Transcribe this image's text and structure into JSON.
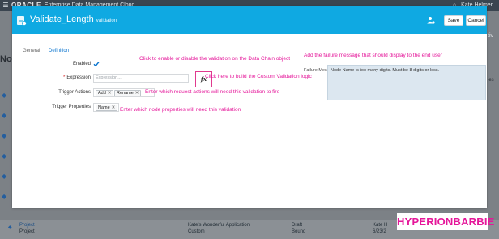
{
  "topbar": {
    "brand": "ORACLE",
    "product": "Enterprise Data Management Cloud",
    "user": "Kate Helmer",
    "home_glyph": "⌂"
  },
  "background": {
    "left_letters": "No",
    "right_text": "tiv",
    "right_text2": "ies",
    "row": {
      "name": "Project",
      "sub": "Project",
      "app": "Kate's Wonderful Application",
      "app_sub": "Custom",
      "status": "Draft",
      "status2": "Bound",
      "owner": "Kate H",
      "date": "6/23/2"
    }
  },
  "modal": {
    "title": "Validate_Length",
    "subtitle": "validation",
    "save_label": "Save",
    "cancel_label": "Cancel",
    "tabs": [
      {
        "label": "General"
      },
      {
        "label": "Definition"
      }
    ],
    "fields": {
      "enabled_label": "Enabled",
      "expression_label": "Expression",
      "expression_placeholder": "Expression...",
      "fx_label": "fx",
      "trigger_actions_label": "Trigger Actions",
      "trigger_actions": [
        {
          "label": "Add"
        },
        {
          "label": "Rename"
        }
      ],
      "trigger_properties_label": "Trigger Properties",
      "trigger_properties": [
        {
          "label": "Name"
        }
      ],
      "failure_message_label": "Failure Message",
      "failure_message": "Node Name is too many digits. Must be 8 digits or less."
    }
  },
  "annotations": {
    "enable": "Click to enable or disable the validation on the Data Chain object",
    "failure": "Add the failure message that should display to the end user",
    "build": "Click here to build the Custom Validation logic",
    "actions": "Enter which request actions will need this validation to fire",
    "properties": "Enter which node properties will need this validation"
  },
  "watermark": "HYPERIONBARBIE",
  "colors": {
    "header": "#0fa9e2",
    "annotation": "#e5179a",
    "failure_box": "#dce7f0",
    "tab_active": "#0572ce"
  }
}
